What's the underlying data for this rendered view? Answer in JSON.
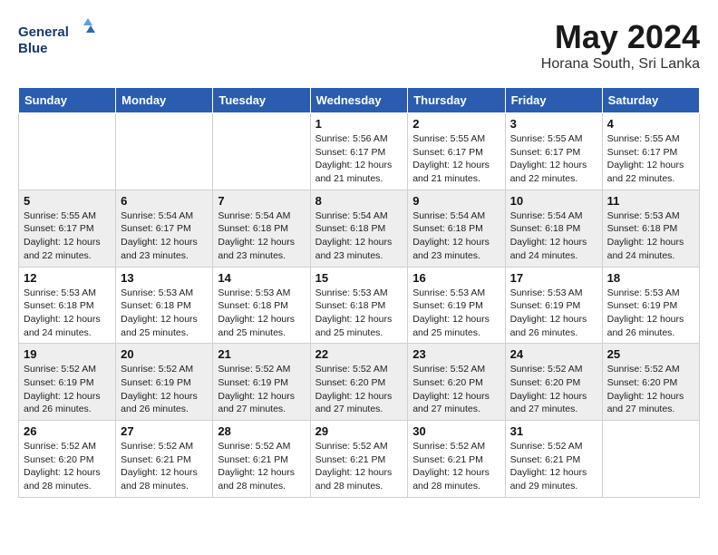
{
  "header": {
    "logo_line1": "General",
    "logo_line2": "Blue",
    "month_title": "May 2024",
    "location": "Horana South, Sri Lanka"
  },
  "weekdays": [
    "Sunday",
    "Monday",
    "Tuesday",
    "Wednesday",
    "Thursday",
    "Friday",
    "Saturday"
  ],
  "weeks": [
    [
      {
        "day": "",
        "sunrise": "",
        "sunset": "",
        "daylight": ""
      },
      {
        "day": "",
        "sunrise": "",
        "sunset": "",
        "daylight": ""
      },
      {
        "day": "",
        "sunrise": "",
        "sunset": "",
        "daylight": ""
      },
      {
        "day": "1",
        "sunrise": "Sunrise: 5:56 AM",
        "sunset": "Sunset: 6:17 PM",
        "daylight": "Daylight: 12 hours and 21 minutes."
      },
      {
        "day": "2",
        "sunrise": "Sunrise: 5:55 AM",
        "sunset": "Sunset: 6:17 PM",
        "daylight": "Daylight: 12 hours and 21 minutes."
      },
      {
        "day": "3",
        "sunrise": "Sunrise: 5:55 AM",
        "sunset": "Sunset: 6:17 PM",
        "daylight": "Daylight: 12 hours and 22 minutes."
      },
      {
        "day": "4",
        "sunrise": "Sunrise: 5:55 AM",
        "sunset": "Sunset: 6:17 PM",
        "daylight": "Daylight: 12 hours and 22 minutes."
      }
    ],
    [
      {
        "day": "5",
        "sunrise": "Sunrise: 5:55 AM",
        "sunset": "Sunset: 6:17 PM",
        "daylight": "Daylight: 12 hours and 22 minutes."
      },
      {
        "day": "6",
        "sunrise": "Sunrise: 5:54 AM",
        "sunset": "Sunset: 6:17 PM",
        "daylight": "Daylight: 12 hours and 23 minutes."
      },
      {
        "day": "7",
        "sunrise": "Sunrise: 5:54 AM",
        "sunset": "Sunset: 6:18 PM",
        "daylight": "Daylight: 12 hours and 23 minutes."
      },
      {
        "day": "8",
        "sunrise": "Sunrise: 5:54 AM",
        "sunset": "Sunset: 6:18 PM",
        "daylight": "Daylight: 12 hours and 23 minutes."
      },
      {
        "day": "9",
        "sunrise": "Sunrise: 5:54 AM",
        "sunset": "Sunset: 6:18 PM",
        "daylight": "Daylight: 12 hours and 23 minutes."
      },
      {
        "day": "10",
        "sunrise": "Sunrise: 5:54 AM",
        "sunset": "Sunset: 6:18 PM",
        "daylight": "Daylight: 12 hours and 24 minutes."
      },
      {
        "day": "11",
        "sunrise": "Sunrise: 5:53 AM",
        "sunset": "Sunset: 6:18 PM",
        "daylight": "Daylight: 12 hours and 24 minutes."
      }
    ],
    [
      {
        "day": "12",
        "sunrise": "Sunrise: 5:53 AM",
        "sunset": "Sunset: 6:18 PM",
        "daylight": "Daylight: 12 hours and 24 minutes."
      },
      {
        "day": "13",
        "sunrise": "Sunrise: 5:53 AM",
        "sunset": "Sunset: 6:18 PM",
        "daylight": "Daylight: 12 hours and 25 minutes."
      },
      {
        "day": "14",
        "sunrise": "Sunrise: 5:53 AM",
        "sunset": "Sunset: 6:18 PM",
        "daylight": "Daylight: 12 hours and 25 minutes."
      },
      {
        "day": "15",
        "sunrise": "Sunrise: 5:53 AM",
        "sunset": "Sunset: 6:18 PM",
        "daylight": "Daylight: 12 hours and 25 minutes."
      },
      {
        "day": "16",
        "sunrise": "Sunrise: 5:53 AM",
        "sunset": "Sunset: 6:19 PM",
        "daylight": "Daylight: 12 hours and 25 minutes."
      },
      {
        "day": "17",
        "sunrise": "Sunrise: 5:53 AM",
        "sunset": "Sunset: 6:19 PM",
        "daylight": "Daylight: 12 hours and 26 minutes."
      },
      {
        "day": "18",
        "sunrise": "Sunrise: 5:53 AM",
        "sunset": "Sunset: 6:19 PM",
        "daylight": "Daylight: 12 hours and 26 minutes."
      }
    ],
    [
      {
        "day": "19",
        "sunrise": "Sunrise: 5:52 AM",
        "sunset": "Sunset: 6:19 PM",
        "daylight": "Daylight: 12 hours and 26 minutes."
      },
      {
        "day": "20",
        "sunrise": "Sunrise: 5:52 AM",
        "sunset": "Sunset: 6:19 PM",
        "daylight": "Daylight: 12 hours and 26 minutes."
      },
      {
        "day": "21",
        "sunrise": "Sunrise: 5:52 AM",
        "sunset": "Sunset: 6:19 PM",
        "daylight": "Daylight: 12 hours and 27 minutes."
      },
      {
        "day": "22",
        "sunrise": "Sunrise: 5:52 AM",
        "sunset": "Sunset: 6:20 PM",
        "daylight": "Daylight: 12 hours and 27 minutes."
      },
      {
        "day": "23",
        "sunrise": "Sunrise: 5:52 AM",
        "sunset": "Sunset: 6:20 PM",
        "daylight": "Daylight: 12 hours and 27 minutes."
      },
      {
        "day": "24",
        "sunrise": "Sunrise: 5:52 AM",
        "sunset": "Sunset: 6:20 PM",
        "daylight": "Daylight: 12 hours and 27 minutes."
      },
      {
        "day": "25",
        "sunrise": "Sunrise: 5:52 AM",
        "sunset": "Sunset: 6:20 PM",
        "daylight": "Daylight: 12 hours and 27 minutes."
      }
    ],
    [
      {
        "day": "26",
        "sunrise": "Sunrise: 5:52 AM",
        "sunset": "Sunset: 6:20 PM",
        "daylight": "Daylight: 12 hours and 28 minutes."
      },
      {
        "day": "27",
        "sunrise": "Sunrise: 5:52 AM",
        "sunset": "Sunset: 6:21 PM",
        "daylight": "Daylight: 12 hours and 28 minutes."
      },
      {
        "day": "28",
        "sunrise": "Sunrise: 5:52 AM",
        "sunset": "Sunset: 6:21 PM",
        "daylight": "Daylight: 12 hours and 28 minutes."
      },
      {
        "day": "29",
        "sunrise": "Sunrise: 5:52 AM",
        "sunset": "Sunset: 6:21 PM",
        "daylight": "Daylight: 12 hours and 28 minutes."
      },
      {
        "day": "30",
        "sunrise": "Sunrise: 5:52 AM",
        "sunset": "Sunset: 6:21 PM",
        "daylight": "Daylight: 12 hours and 28 minutes."
      },
      {
        "day": "31",
        "sunrise": "Sunrise: 5:52 AM",
        "sunset": "Sunset: 6:21 PM",
        "daylight": "Daylight: 12 hours and 29 minutes."
      },
      {
        "day": "",
        "sunrise": "",
        "sunset": "",
        "daylight": ""
      }
    ]
  ]
}
